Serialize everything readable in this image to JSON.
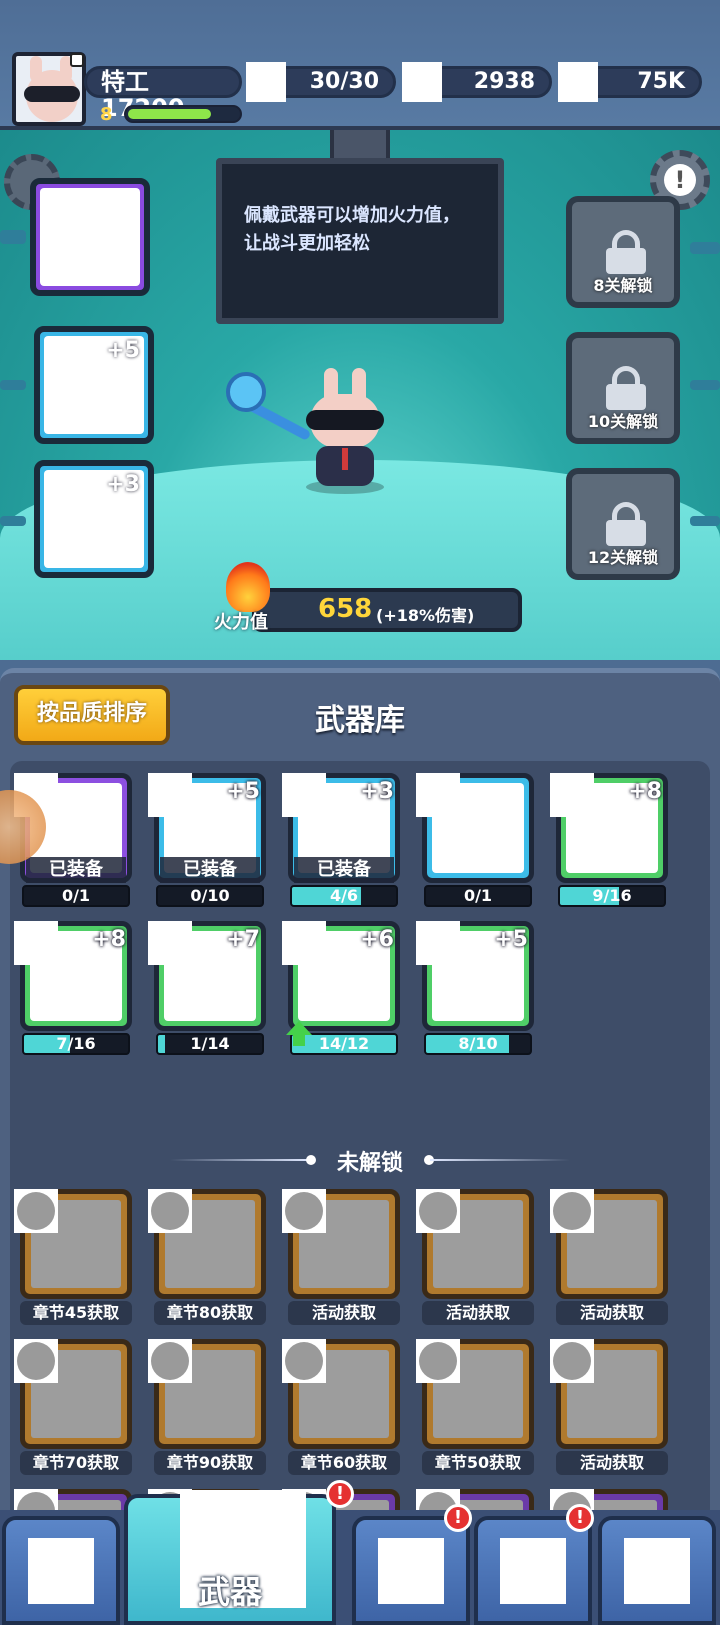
{
  "player": {
    "name": "特工17200",
    "level": "8",
    "xp_fraction": 0.75
  },
  "resources": [
    {
      "icon": "energy-icon",
      "value": "30/30"
    },
    {
      "icon": "gem-icon",
      "value": "2938"
    },
    {
      "icon": "coin-icon",
      "value": "75K"
    }
  ],
  "scene": {
    "tip": "佩戴武器可以增加火力值，让战斗更加轻松",
    "equipped_slots": [
      {
        "quality": "purple",
        "plus": ""
      },
      {
        "quality": "blue",
        "plus": "+5"
      },
      {
        "quality": "blue",
        "plus": "+3"
      }
    ],
    "locked_slots": [
      "8关解锁",
      "10关解锁",
      "12关解锁"
    ],
    "power": {
      "label": "火力值",
      "value": "658",
      "bonus": "(+18%伤害)"
    }
  },
  "library": {
    "sort_button": "按品质排序",
    "title": "武器库",
    "owned": [
      {
        "quality": "purple",
        "level": "",
        "equipped": "已装备",
        "count": "0/1",
        "fill": 0
      },
      {
        "quality": "blue",
        "level": "+5",
        "equipped": "已装备",
        "count": "0/10",
        "fill": 0
      },
      {
        "quality": "blue",
        "level": "+3",
        "equipped": "已装备",
        "count": "4/6",
        "fill": 0.667
      },
      {
        "quality": "blue",
        "level": "",
        "equipped": "",
        "count": "0/1",
        "fill": 0
      },
      {
        "quality": "green",
        "level": "+8",
        "equipped": "",
        "count": "9/16",
        "fill": 0.5625
      },
      {
        "quality": "green",
        "level": "+8",
        "equipped": "",
        "count": "7/16",
        "fill": 0.4375
      },
      {
        "quality": "green",
        "level": "+7",
        "equipped": "",
        "count": "1/14",
        "fill": 0.071
      },
      {
        "quality": "green",
        "level": "+6",
        "equipped": "",
        "count": "14/12",
        "fill": 1,
        "upgrade": true
      },
      {
        "quality": "green",
        "level": "+5",
        "equipped": "",
        "count": "8/10",
        "fill": 0.8
      }
    ],
    "locked_label": "未解锁",
    "locked": [
      {
        "how": "章节45获取"
      },
      {
        "how": "章节80获取"
      },
      {
        "how": "活动获取"
      },
      {
        "how": "活动获取"
      },
      {
        "how": "活动获取"
      },
      {
        "how": "章节70获取"
      },
      {
        "how": "章节90获取"
      },
      {
        "how": "章节60获取"
      },
      {
        "how": "章节50获取"
      },
      {
        "how": "活动获取"
      },
      {
        "how": ""
      },
      {
        "how": ""
      },
      {
        "how": ""
      },
      {
        "how": ""
      },
      {
        "how": ""
      }
    ]
  },
  "nav": {
    "tabs": [
      {
        "label": "",
        "badge": "",
        "active": false
      },
      {
        "label": "武器",
        "badge": "!",
        "active": true
      },
      {
        "label": "",
        "badge": "!",
        "active": false
      },
      {
        "label": "",
        "badge": "!",
        "active": false
      },
      {
        "label": "",
        "badge": "",
        "active": false
      }
    ]
  },
  "colors": {
    "purple": "#8c4fe0",
    "blue": "#3cbce8",
    "green": "#4fce67",
    "gold": "#ffd63a"
  }
}
